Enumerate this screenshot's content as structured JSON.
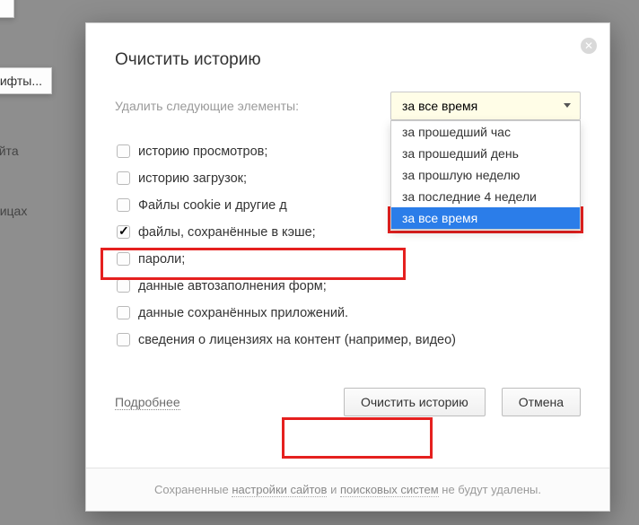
{
  "background": {
    "fonts_button": "рифты...",
    "site_label": "ы сайта",
    "pages_label": "траницах"
  },
  "dialog": {
    "title": "Очистить историю",
    "close_icon": "✕",
    "delete_label": "Удалить следующие элементы:",
    "select": {
      "current": "за все время",
      "options": [
        "за прошедший час",
        "за прошедший день",
        "за прошлую неделю",
        "за последние 4 недели",
        "за все время"
      ],
      "selected_index": 4
    },
    "items": [
      {
        "label": "историю просмотров;",
        "checked": false
      },
      {
        "label": "историю загрузок;",
        "checked": false
      },
      {
        "label": "Файлы cookie и другие д",
        "checked": false
      },
      {
        "label": "файлы, сохранённые в кэше;",
        "checked": true
      },
      {
        "label": "пароли;",
        "checked": false
      },
      {
        "label": "данные автозаполнения форм;",
        "checked": false
      },
      {
        "label": "данные сохранённых приложений.",
        "checked": false
      },
      {
        "label": "сведения о лицензиях на контент (например, видео)",
        "checked": false
      }
    ],
    "more_link": "Подробнее",
    "primary_button": "Очистить историю",
    "cancel_button": "Отмена",
    "footer": {
      "prefix": "Сохраненные ",
      "link1": "настройки сайтов",
      "mid": " и ",
      "link2": "поисковых систем",
      "suffix": " не будут удалены."
    }
  }
}
